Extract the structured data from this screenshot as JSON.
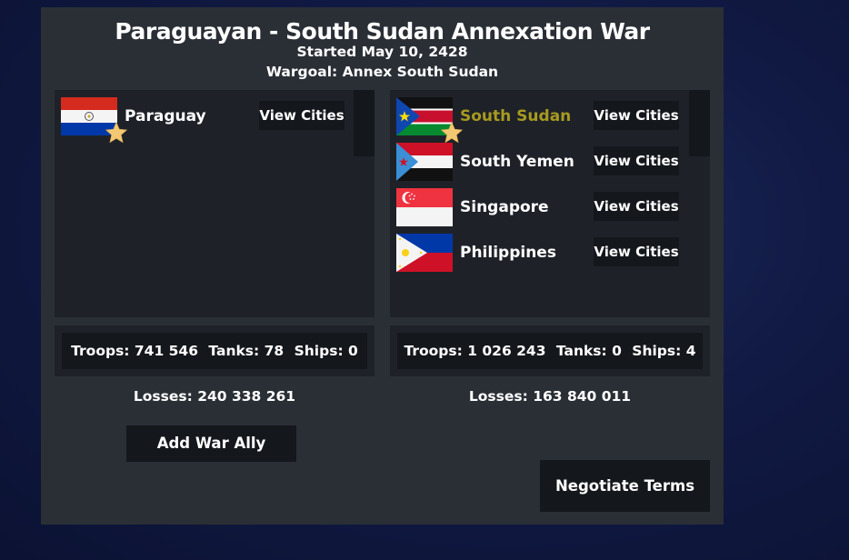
{
  "war": {
    "title": "Paraguayan - South Sudan Annexation War",
    "started": "Started May 10, 2428",
    "wargoal": "Wargoal: Annex South Sudan"
  },
  "attackers": {
    "countries": [
      {
        "name": "Paraguay",
        "flag": "paraguay-flag",
        "leader": true,
        "view_label": "View Cities"
      }
    ],
    "stats": {
      "troops": "Troops: 741 546",
      "tanks": "Tanks: 78",
      "ships": "Ships: 0"
    },
    "losses": "Losses: 240 338 261"
  },
  "defenders": {
    "countries": [
      {
        "name": "South Sudan",
        "flag": "south-sudan-flag",
        "leader": true,
        "view_label": "View Cities"
      },
      {
        "name": "South Yemen",
        "flag": "south-yemen-flag",
        "leader": false,
        "view_label": "View Cities"
      },
      {
        "name": "Singapore",
        "flag": "singapore-flag",
        "leader": false,
        "view_label": "View Cities"
      },
      {
        "name": "Philippines",
        "flag": "philippines-flag",
        "leader": false,
        "view_label": "View Cities"
      }
    ],
    "stats": {
      "troops": "Troops: 1 026 243",
      "tanks": "Tanks: 0",
      "ships": "Ships: 4"
    },
    "losses": "Losses: 163 840 011"
  },
  "actions": {
    "add_ally": "Add War Ally",
    "negotiate": "Negotiate Terms"
  },
  "colors": {
    "panel_bg": "#2a2f36",
    "list_bg": "#1e2228",
    "button_bg": "#14171c",
    "highlight_name": "#a89a20",
    "star": "#f2c873"
  },
  "icons": {
    "leader": "star-icon"
  }
}
